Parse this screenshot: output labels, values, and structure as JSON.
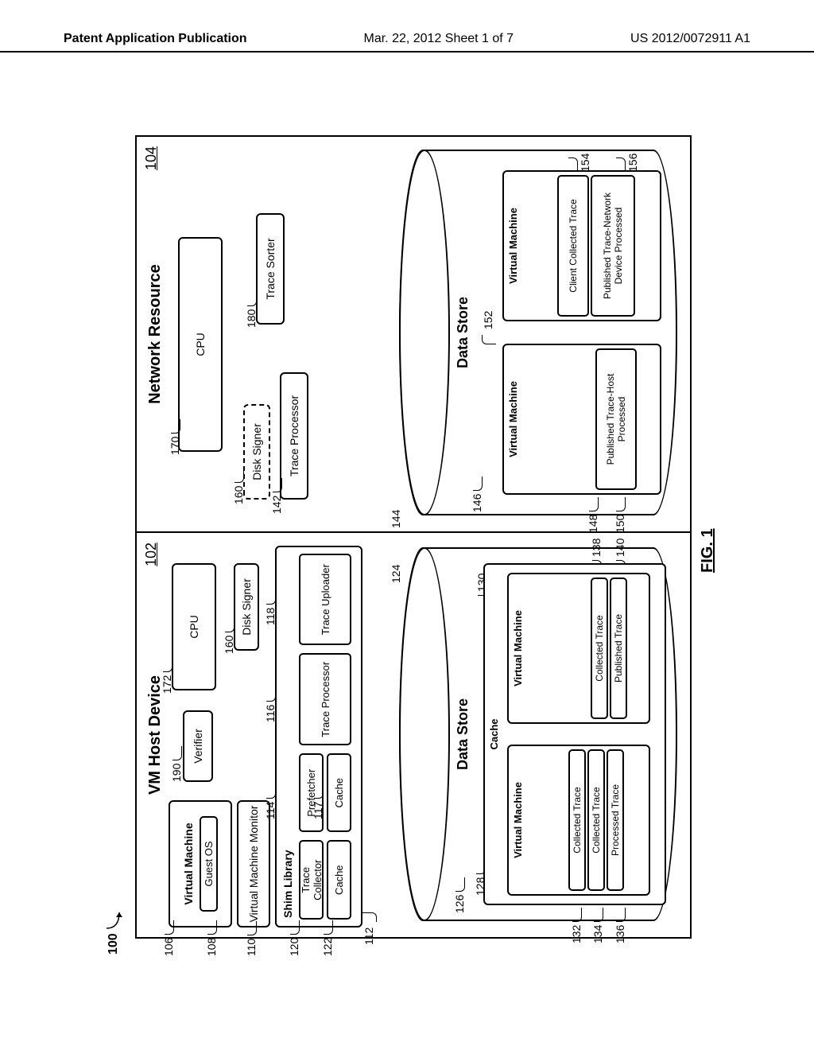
{
  "header": {
    "left": "Patent Application Publication",
    "center": "Mar. 22, 2012  Sheet 1 of 7",
    "right": "US 2012/0072911 A1"
  },
  "figure_label": "FIG. 1",
  "system_ref": "100",
  "host": {
    "title": "VM Host Device",
    "ref": "102",
    "vm": {
      "label": "Virtual Machine",
      "ref": "106",
      "guest_os": "Guest OS",
      "guest_os_ref": "108"
    },
    "vmm": {
      "label": "Virtual Machine Monitor",
      "ref": "110"
    },
    "verifier": {
      "label": "Verifier",
      "ref": "190"
    },
    "cpu": {
      "label": "CPU",
      "ref": "172"
    },
    "disk_signer": {
      "label": "Disk Signer",
      "ref": "160"
    },
    "shim": {
      "label": "Shim Library",
      "ref": "112",
      "trace_collector": {
        "label": "Trace Collector",
        "ref": "120"
      },
      "cache1": {
        "label": "Cache",
        "ref": "122"
      },
      "prefetcher": {
        "label": "Prefetcher",
        "ref": "114"
      },
      "cache2": {
        "label": "Cache",
        "ref": "117"
      },
      "trace_processor": {
        "label": "Trace Processor",
        "ref": "116"
      },
      "trace_uploader": {
        "label": "Trace Uploader",
        "ref": "118"
      }
    },
    "datastore": {
      "label": "Data Store",
      "ref": "124",
      "cache": {
        "label": "Cache",
        "ref": "126",
        "vm1": {
          "label": "Virtual Machine",
          "ref": "128",
          "collected1": {
            "label": "Collected Trace",
            "ref": "132"
          },
          "collected2": {
            "label": "Collected Trace",
            "ref": "134"
          },
          "processed": {
            "label": "Processed Trace",
            "ref": "136"
          }
        },
        "vm2": {
          "label": "Virtual Machine",
          "ref": "130",
          "collected": {
            "label": "Collected Trace",
            "ref": "138"
          },
          "published": {
            "label": "Published Trace",
            "ref": "140"
          }
        }
      }
    }
  },
  "net": {
    "title": "Network Resource",
    "ref": "104",
    "cpu": {
      "label": "CPU",
      "ref": "170"
    },
    "disk_signer": {
      "label": "Disk Signer",
      "ref": "160"
    },
    "trace_processor": {
      "label": "Trace Processor",
      "ref": "142"
    },
    "trace_sorter": {
      "label": "Trace Sorter",
      "ref": "180"
    },
    "datastore": {
      "label": "Data Store",
      "ref": "144",
      "inner_ref": "152",
      "vm1": {
        "label": "Virtual Machine",
        "ref": "146",
        "pub_host": {
          "label": "Published Trace-Host Processed",
          "ref": "150"
        },
        "tag_ref": "148"
      },
      "vm2": {
        "label": "Virtual Machine",
        "client_collected": {
          "label": "Client Collected Trace",
          "ref": "154"
        },
        "pub_net": {
          "label": "Published Trace-Network Device Processed",
          "ref": "156"
        }
      }
    }
  }
}
